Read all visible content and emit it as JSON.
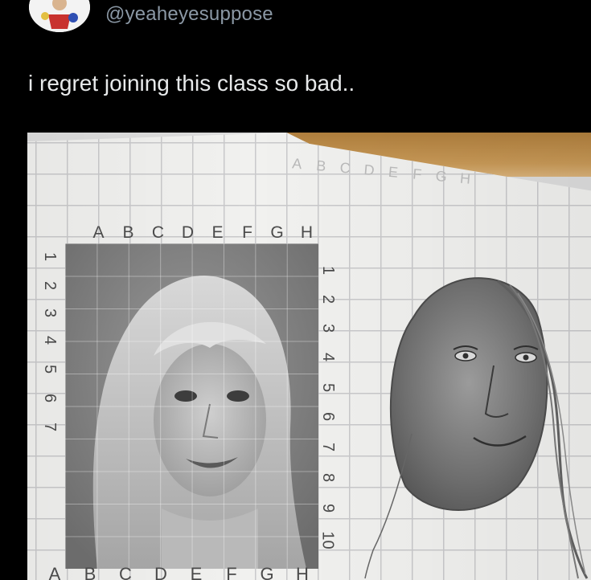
{
  "post": {
    "handle": "@yeaheyesuppose",
    "text": "i regret joining this class so bad.."
  },
  "photo": {
    "paper_faint_letters": [
      "A",
      "B",
      "C",
      "D",
      "E",
      "F",
      "G",
      "H"
    ],
    "portrait_top_letters": [
      "A",
      "B",
      "C",
      "D",
      "E",
      "F",
      "G",
      "H"
    ],
    "portrait_bottom_letters": [
      "A",
      "B",
      "C",
      "D",
      "E",
      "F",
      "G",
      "H"
    ],
    "portrait_left_numbers": [
      "1",
      "2",
      "3",
      "4",
      "5",
      "6",
      "7"
    ],
    "portrait_right_numbers": [
      "1",
      "2",
      "3",
      "4",
      "5",
      "6",
      "7",
      "8",
      "9",
      "10"
    ]
  },
  "colors": {
    "background": "#000000",
    "text": "#e7e9ea",
    "handle": "#8b98a5",
    "paper": "#f1f1ef",
    "desk": "#c89957"
  },
  "icons": {
    "avatar": "avatar-illustration"
  }
}
